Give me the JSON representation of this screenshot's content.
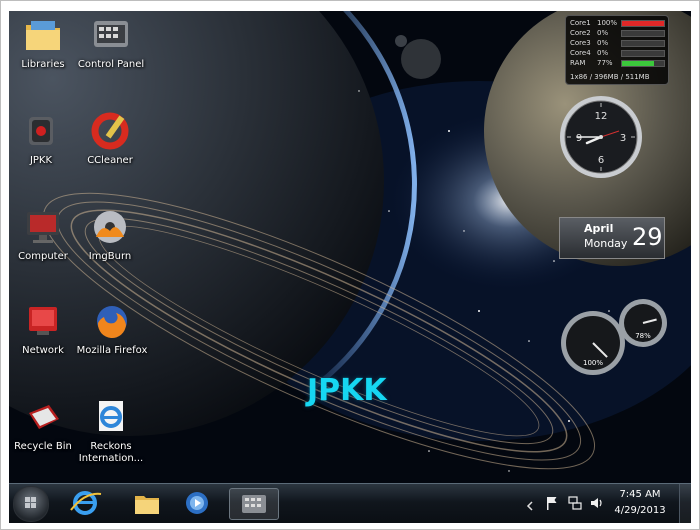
{
  "desktop_icons": [
    {
      "name": "libraries-icon",
      "label": "Libraries"
    },
    {
      "name": "control-panel-icon",
      "label": "Control Panel"
    },
    {
      "name": "jpkk-icon",
      "label": "JPKK"
    },
    {
      "name": "ccleaner-icon",
      "label": "CCleaner"
    },
    {
      "name": "computer-icon",
      "label": "Computer"
    },
    {
      "name": "imgburn-icon",
      "label": "ImgBurn"
    },
    {
      "name": "network-icon",
      "label": "Network"
    },
    {
      "name": "firefox-icon",
      "label": "Mozilla Firefox"
    },
    {
      "name": "recycle-bin-icon",
      "label": "Recycle Bin"
    },
    {
      "name": "reckons-icon",
      "label": "Reckons",
      "label2": "Internation..."
    }
  ],
  "cpu_gadget": {
    "rows": [
      {
        "name": "Core1",
        "percent": "100%",
        "fill": 1.0,
        "color": "#e02828"
      },
      {
        "name": "Core2",
        "percent": "0%",
        "fill": 0.0,
        "color": "#3cc83c"
      },
      {
        "name": "Core3",
        "percent": "0%",
        "fill": 0.0,
        "color": "#3cc83c"
      },
      {
        "name": "Core4",
        "percent": "0%",
        "fill": 0.0,
        "color": "#3cc83c"
      },
      {
        "name": "RAM",
        "percent": "77%",
        "fill": 0.77,
        "color": "#3cc83c"
      }
    ],
    "footer": "1x86 / 396MB / 511MB"
  },
  "clock_gadget": {
    "numerals": [
      "12",
      "3",
      "6",
      "9"
    ],
    "time_shown": "7:45"
  },
  "calendar_gadget": {
    "month": "April",
    "weekday": "Monday",
    "day": "29"
  },
  "meter_gadget": {
    "cpu_label": "100%",
    "cpu_level": 1.0,
    "ram_label": "78%",
    "ram_level": 0.78
  },
  "watermark": "JPKK",
  "taskbar": {
    "time": "7:45 AM",
    "date": "4/29/2013",
    "pinned": [
      "internet-explorer-icon",
      "windows-explorer-icon",
      "media-player-icon",
      "control-panel-taskbar-icon"
    ],
    "tray": [
      "action-center-flag-icon",
      "network-tray-icon",
      "volume-icon"
    ]
  },
  "colors": {
    "watermark": "#16d7f2",
    "core_high": "#e02828",
    "core_low": "#3cc83c"
  }
}
